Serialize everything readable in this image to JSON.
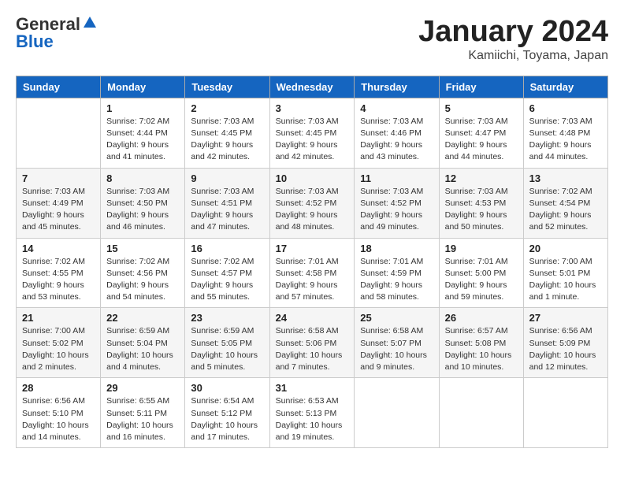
{
  "header": {
    "logo_general": "General",
    "logo_blue": "Blue",
    "month_title": "January 2024",
    "location": "Kamiichi, Toyama, Japan"
  },
  "days_of_week": [
    "Sunday",
    "Monday",
    "Tuesday",
    "Wednesday",
    "Thursday",
    "Friday",
    "Saturday"
  ],
  "weeks": [
    [
      {
        "day": "",
        "info": ""
      },
      {
        "day": "1",
        "info": "Sunrise: 7:02 AM\nSunset: 4:44 PM\nDaylight: 9 hours\nand 41 minutes."
      },
      {
        "day": "2",
        "info": "Sunrise: 7:03 AM\nSunset: 4:45 PM\nDaylight: 9 hours\nand 42 minutes."
      },
      {
        "day": "3",
        "info": "Sunrise: 7:03 AM\nSunset: 4:45 PM\nDaylight: 9 hours\nand 42 minutes."
      },
      {
        "day": "4",
        "info": "Sunrise: 7:03 AM\nSunset: 4:46 PM\nDaylight: 9 hours\nand 43 minutes."
      },
      {
        "day": "5",
        "info": "Sunrise: 7:03 AM\nSunset: 4:47 PM\nDaylight: 9 hours\nand 44 minutes."
      },
      {
        "day": "6",
        "info": "Sunrise: 7:03 AM\nSunset: 4:48 PM\nDaylight: 9 hours\nand 44 minutes."
      }
    ],
    [
      {
        "day": "7",
        "info": "Sunrise: 7:03 AM\nSunset: 4:49 PM\nDaylight: 9 hours\nand 45 minutes."
      },
      {
        "day": "8",
        "info": "Sunrise: 7:03 AM\nSunset: 4:50 PM\nDaylight: 9 hours\nand 46 minutes."
      },
      {
        "day": "9",
        "info": "Sunrise: 7:03 AM\nSunset: 4:51 PM\nDaylight: 9 hours\nand 47 minutes."
      },
      {
        "day": "10",
        "info": "Sunrise: 7:03 AM\nSunset: 4:52 PM\nDaylight: 9 hours\nand 48 minutes."
      },
      {
        "day": "11",
        "info": "Sunrise: 7:03 AM\nSunset: 4:52 PM\nDaylight: 9 hours\nand 49 minutes."
      },
      {
        "day": "12",
        "info": "Sunrise: 7:03 AM\nSunset: 4:53 PM\nDaylight: 9 hours\nand 50 minutes."
      },
      {
        "day": "13",
        "info": "Sunrise: 7:02 AM\nSunset: 4:54 PM\nDaylight: 9 hours\nand 52 minutes."
      }
    ],
    [
      {
        "day": "14",
        "info": "Sunrise: 7:02 AM\nSunset: 4:55 PM\nDaylight: 9 hours\nand 53 minutes."
      },
      {
        "day": "15",
        "info": "Sunrise: 7:02 AM\nSunset: 4:56 PM\nDaylight: 9 hours\nand 54 minutes."
      },
      {
        "day": "16",
        "info": "Sunrise: 7:02 AM\nSunset: 4:57 PM\nDaylight: 9 hours\nand 55 minutes."
      },
      {
        "day": "17",
        "info": "Sunrise: 7:01 AM\nSunset: 4:58 PM\nDaylight: 9 hours\nand 57 minutes."
      },
      {
        "day": "18",
        "info": "Sunrise: 7:01 AM\nSunset: 4:59 PM\nDaylight: 9 hours\nand 58 minutes."
      },
      {
        "day": "19",
        "info": "Sunrise: 7:01 AM\nSunset: 5:00 PM\nDaylight: 9 hours\nand 59 minutes."
      },
      {
        "day": "20",
        "info": "Sunrise: 7:00 AM\nSunset: 5:01 PM\nDaylight: 10 hours\nand 1 minute."
      }
    ],
    [
      {
        "day": "21",
        "info": "Sunrise: 7:00 AM\nSunset: 5:02 PM\nDaylight: 10 hours\nand 2 minutes."
      },
      {
        "day": "22",
        "info": "Sunrise: 6:59 AM\nSunset: 5:04 PM\nDaylight: 10 hours\nand 4 minutes."
      },
      {
        "day": "23",
        "info": "Sunrise: 6:59 AM\nSunset: 5:05 PM\nDaylight: 10 hours\nand 5 minutes."
      },
      {
        "day": "24",
        "info": "Sunrise: 6:58 AM\nSunset: 5:06 PM\nDaylight: 10 hours\nand 7 minutes."
      },
      {
        "day": "25",
        "info": "Sunrise: 6:58 AM\nSunset: 5:07 PM\nDaylight: 10 hours\nand 9 minutes."
      },
      {
        "day": "26",
        "info": "Sunrise: 6:57 AM\nSunset: 5:08 PM\nDaylight: 10 hours\nand 10 minutes."
      },
      {
        "day": "27",
        "info": "Sunrise: 6:56 AM\nSunset: 5:09 PM\nDaylight: 10 hours\nand 12 minutes."
      }
    ],
    [
      {
        "day": "28",
        "info": "Sunrise: 6:56 AM\nSunset: 5:10 PM\nDaylight: 10 hours\nand 14 minutes."
      },
      {
        "day": "29",
        "info": "Sunrise: 6:55 AM\nSunset: 5:11 PM\nDaylight: 10 hours\nand 16 minutes."
      },
      {
        "day": "30",
        "info": "Sunrise: 6:54 AM\nSunset: 5:12 PM\nDaylight: 10 hours\nand 17 minutes."
      },
      {
        "day": "31",
        "info": "Sunrise: 6:53 AM\nSunset: 5:13 PM\nDaylight: 10 hours\nand 19 minutes."
      },
      {
        "day": "",
        "info": ""
      },
      {
        "day": "",
        "info": ""
      },
      {
        "day": "",
        "info": ""
      }
    ]
  ]
}
